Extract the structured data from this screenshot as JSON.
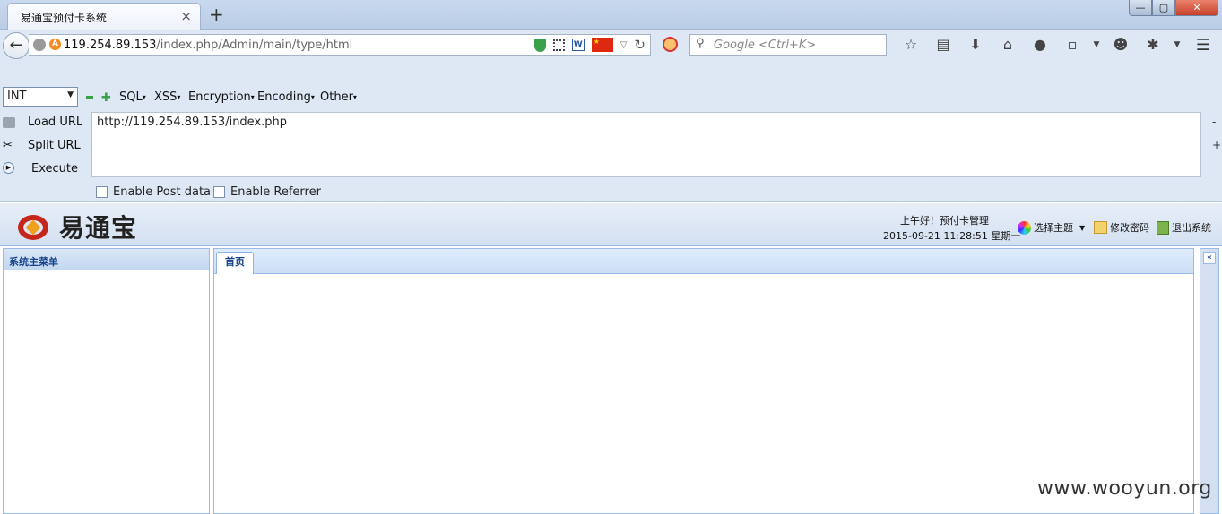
{
  "browser": {
    "tab_title": "易通宝预付卡系统",
    "tab_close": "×",
    "new_tab": "+",
    "window_min": "—",
    "window_max": "▢",
    "window_close": "✕",
    "back": "←",
    "url_host": "119.254.89.153",
    "url_path": "/index.php/Admin/main/type/html",
    "search_placeholder": "Google <Ctrl+K>",
    "menu": "☰"
  },
  "hackbar": {
    "select_value": "INT",
    "menus": [
      "SQL",
      "XSS",
      "Encryption",
      "Encoding",
      "Other"
    ],
    "load_url": "Load URL",
    "split_url": "Split URL",
    "execute": "Execute",
    "url_value": "http://119.254.89.153/index.php",
    "minus": "-",
    "plus": "+",
    "enable_post": "Enable Post data",
    "enable_referrer": "Enable Referrer"
  },
  "app": {
    "logo_text": "易通宝",
    "greeting": "上午好！预付卡管理",
    "datetime": "2015-09-21 11:28:51 星期一",
    "choose_theme": "选择主题",
    "change_password": "修改密码",
    "logout": "退出系统",
    "west_title": "系统主菜单",
    "home_tab": "首页",
    "collapse": "«"
  },
  "watermark": "www.wooyun.org"
}
